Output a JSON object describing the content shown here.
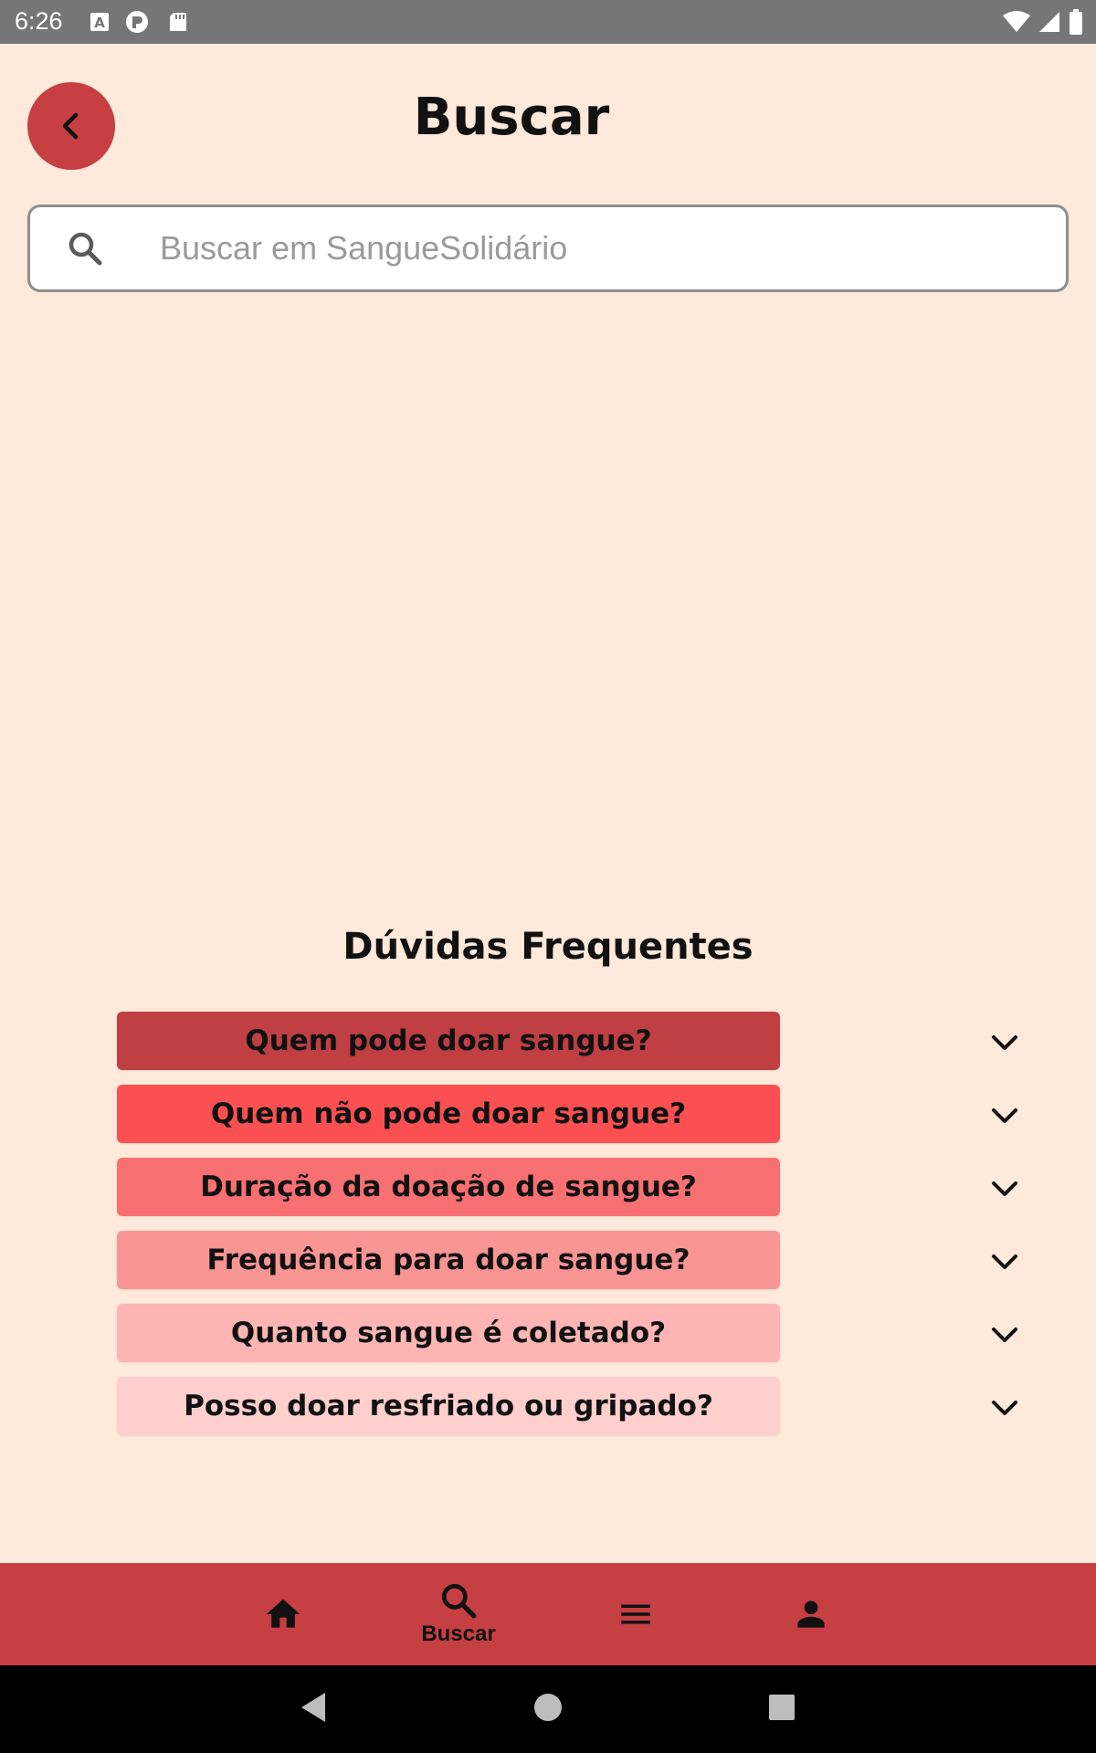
{
  "status_bar": {
    "time": "6:26",
    "icons": [
      "keyboard-a-icon",
      "notification-p-icon",
      "sd-card-icon",
      "wifi-icon",
      "signal-icon",
      "battery-icon"
    ]
  },
  "header": {
    "title": "Buscar",
    "back_icon": "chevron-left-icon"
  },
  "search": {
    "placeholder": "Buscar em SangueSolidário",
    "value": ""
  },
  "faq": {
    "title": "Dúvidas Frequentes",
    "items": [
      {
        "question": "Quem pode doar sangue?",
        "color": "#bf3f43"
      },
      {
        "question": "Quem não pode doar sangue?",
        "color": "#fa5052"
      },
      {
        "question": "Duração da doação de sangue?",
        "color": "#f87071"
      },
      {
        "question": "Frequência para doar sangue?",
        "color": "#f99593"
      },
      {
        "question": "Quanto sangue é coletado?",
        "color": "#feb5b4"
      },
      {
        "question": "Posso doar resfriado ou gripado?",
        "color": "#ffcfcd"
      }
    ]
  },
  "bottom_nav": {
    "items": [
      {
        "icon": "home-icon",
        "label": ""
      },
      {
        "icon": "search-icon",
        "label": "Buscar"
      },
      {
        "icon": "menu-icon",
        "label": ""
      },
      {
        "icon": "person-icon",
        "label": ""
      }
    ]
  },
  "colors": {
    "background": "#fee9da",
    "accent": "#c63f43",
    "status_bar": "#767676"
  }
}
